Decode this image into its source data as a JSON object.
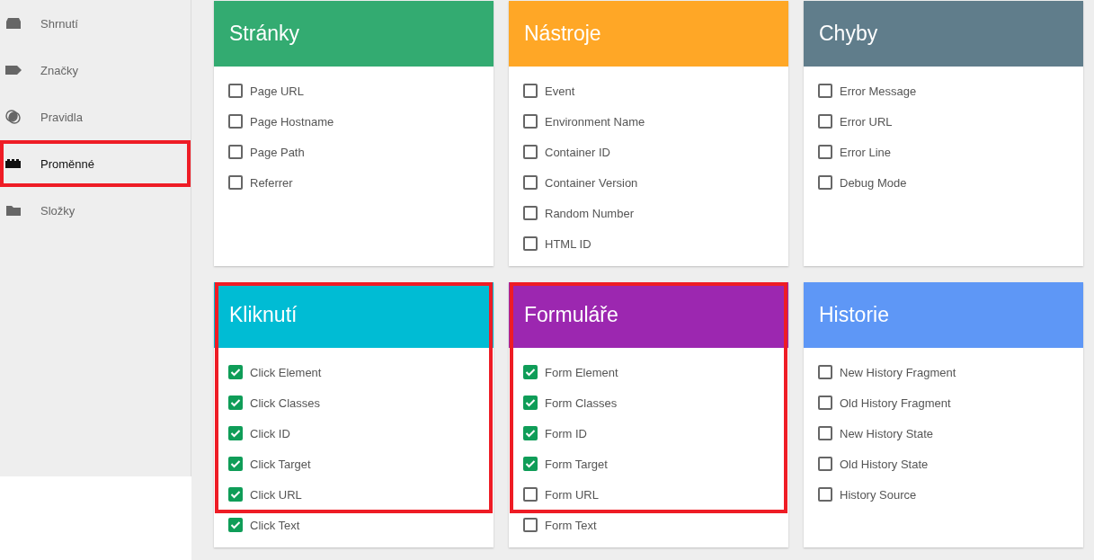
{
  "sidebar": {
    "items": [
      {
        "label": "Shrnutí",
        "kind": "summary",
        "selected": false,
        "highlighted": false
      },
      {
        "label": "Značky",
        "kind": "tag",
        "selected": false,
        "highlighted": false
      },
      {
        "label": "Pravidla",
        "kind": "trigger",
        "selected": false,
        "highlighted": false
      },
      {
        "label": "Proměnné",
        "kind": "brick",
        "selected": true,
        "highlighted": true
      },
      {
        "label": "Složky",
        "kind": "folder",
        "selected": false,
        "highlighted": false
      }
    ]
  },
  "cards": [
    {
      "title": "Stránky",
      "color": "#33ab71",
      "highlighted": false,
      "items": [
        {
          "label": "Page URL",
          "checked": false
        },
        {
          "label": "Page Hostname",
          "checked": false
        },
        {
          "label": "Page Path",
          "checked": false
        },
        {
          "label": "Referrer",
          "checked": false
        }
      ]
    },
    {
      "title": "Nástroje",
      "color": "#ffa726",
      "highlighted": false,
      "items": [
        {
          "label": "Event",
          "checked": false
        },
        {
          "label": "Environment Name",
          "checked": false
        },
        {
          "label": "Container ID",
          "checked": false
        },
        {
          "label": "Container Version",
          "checked": false
        },
        {
          "label": "Random Number",
          "checked": false
        },
        {
          "label": "HTML ID",
          "checked": false
        }
      ]
    },
    {
      "title": "Chyby",
      "color": "#607d8b",
      "highlighted": false,
      "items": [
        {
          "label": "Error Message",
          "checked": false
        },
        {
          "label": "Error URL",
          "checked": false
        },
        {
          "label": "Error Line",
          "checked": false
        },
        {
          "label": "Debug Mode",
          "checked": false
        }
      ]
    },
    {
      "title": "Kliknutí",
      "color": "#00bcd4",
      "highlighted": true,
      "items": [
        {
          "label": "Click Element",
          "checked": true
        },
        {
          "label": "Click Classes",
          "checked": true
        },
        {
          "label": "Click ID",
          "checked": true
        },
        {
          "label": "Click Target",
          "checked": true
        },
        {
          "label": "Click URL",
          "checked": true
        },
        {
          "label": "Click Text",
          "checked": true
        }
      ]
    },
    {
      "title": "Formuláře",
      "color": "#9c27b0",
      "highlighted": true,
      "items": [
        {
          "label": "Form Element",
          "checked": true
        },
        {
          "label": "Form Classes",
          "checked": true
        },
        {
          "label": "Form ID",
          "checked": true
        },
        {
          "label": "Form Target",
          "checked": true
        },
        {
          "label": "Form URL",
          "checked": false
        },
        {
          "label": "Form Text",
          "checked": false
        }
      ]
    },
    {
      "title": "Historie",
      "color": "#5e97f6",
      "highlighted": false,
      "items": [
        {
          "label": "New History Fragment",
          "checked": false
        },
        {
          "label": "Old History Fragment",
          "checked": false
        },
        {
          "label": "New History State",
          "checked": false
        },
        {
          "label": "Old History State",
          "checked": false
        },
        {
          "label": "History Source",
          "checked": false
        }
      ]
    }
  ]
}
